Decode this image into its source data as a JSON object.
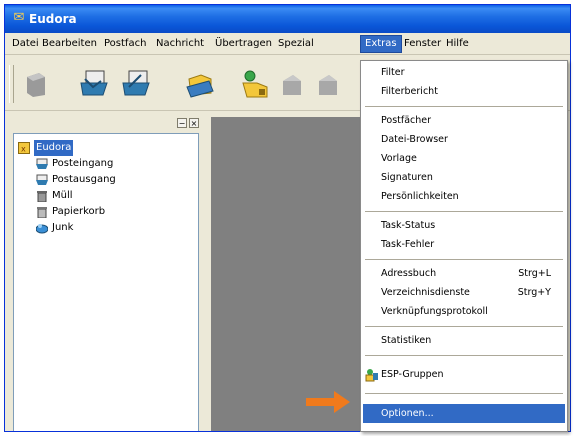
{
  "window": {
    "title": "Eudora"
  },
  "colors": {
    "titlebar": "#0a56d8",
    "highlight": "#316ac5",
    "arrow": "#f07a1c",
    "workspace": "#808080"
  },
  "menubar": {
    "items": [
      "Datei",
      "Bearbeiten",
      "Postfach",
      "Nachricht",
      "Übertragen",
      "Spezial",
      "Extras",
      "Fenster",
      "Hilfe"
    ],
    "active": "Extras"
  },
  "toolbar": {
    "buttons": [
      "mailbox-gray-icon",
      "check-mail-icon",
      "send-mail-icon",
      "new-message-icon",
      "address-book-icon",
      "reply-gray-icon",
      "forward-gray-icon"
    ]
  },
  "folder_pane": {
    "controls": [
      "−",
      "×"
    ],
    "tree": [
      {
        "label": "Eudora",
        "icon": "eudora-folder-icon",
        "selected": true
      },
      {
        "label": "Posteingang",
        "icon": "inbox-icon"
      },
      {
        "label": "Postausgang",
        "icon": "outbox-icon"
      },
      {
        "label": "Müll",
        "icon": "trash-icon"
      },
      {
        "label": "Papierkorb",
        "icon": "recycle-bin-icon"
      },
      {
        "label": "Junk",
        "icon": "junk-icon"
      }
    ]
  },
  "extras_menu": {
    "groups": [
      [
        {
          "label": "Filter"
        },
        {
          "label": "Filterbericht"
        }
      ],
      [
        {
          "label": "Postfächer"
        },
        {
          "label": "Datei-Browser"
        },
        {
          "label": "Vorlage"
        },
        {
          "label": "Signaturen"
        },
        {
          "label": "Persönlichkeiten"
        }
      ],
      [
        {
          "label": "Task-Status"
        },
        {
          "label": "Task-Fehler"
        }
      ],
      [
        {
          "label": "Adressbuch",
          "shortcut": "Strg+L"
        },
        {
          "label": "Verzeichnisdienste",
          "shortcut": "Strg+Y"
        },
        {
          "label": "Verknüpfungsprotokoll"
        }
      ],
      [
        {
          "label": "Statistiken"
        }
      ],
      [
        {
          "label": "ESP-Gruppen",
          "icon": "esp-groups-icon"
        }
      ],
      [
        {
          "label": "Optionen...",
          "highlighted": true
        }
      ]
    ]
  }
}
